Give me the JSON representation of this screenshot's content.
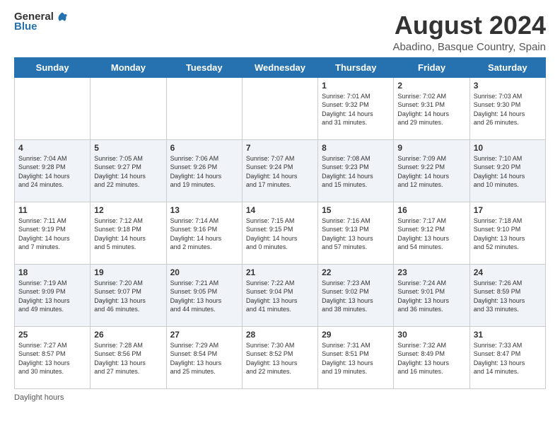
{
  "logo": {
    "general": "General",
    "blue": "Blue"
  },
  "title": "August 2024",
  "subtitle": "Abadino, Basque Country, Spain",
  "headers": [
    "Sunday",
    "Monday",
    "Tuesday",
    "Wednesday",
    "Thursday",
    "Friday",
    "Saturday"
  ],
  "weeks": [
    [
      {
        "day": "",
        "info": ""
      },
      {
        "day": "",
        "info": ""
      },
      {
        "day": "",
        "info": ""
      },
      {
        "day": "",
        "info": ""
      },
      {
        "day": "1",
        "info": "Sunrise: 7:01 AM\nSunset: 9:32 PM\nDaylight: 14 hours\nand 31 minutes."
      },
      {
        "day": "2",
        "info": "Sunrise: 7:02 AM\nSunset: 9:31 PM\nDaylight: 14 hours\nand 29 minutes."
      },
      {
        "day": "3",
        "info": "Sunrise: 7:03 AM\nSunset: 9:30 PM\nDaylight: 14 hours\nand 26 minutes."
      }
    ],
    [
      {
        "day": "4",
        "info": "Sunrise: 7:04 AM\nSunset: 9:28 PM\nDaylight: 14 hours\nand 24 minutes."
      },
      {
        "day": "5",
        "info": "Sunrise: 7:05 AM\nSunset: 9:27 PM\nDaylight: 14 hours\nand 22 minutes."
      },
      {
        "day": "6",
        "info": "Sunrise: 7:06 AM\nSunset: 9:26 PM\nDaylight: 14 hours\nand 19 minutes."
      },
      {
        "day": "7",
        "info": "Sunrise: 7:07 AM\nSunset: 9:24 PM\nDaylight: 14 hours\nand 17 minutes."
      },
      {
        "day": "8",
        "info": "Sunrise: 7:08 AM\nSunset: 9:23 PM\nDaylight: 14 hours\nand 15 minutes."
      },
      {
        "day": "9",
        "info": "Sunrise: 7:09 AM\nSunset: 9:22 PM\nDaylight: 14 hours\nand 12 minutes."
      },
      {
        "day": "10",
        "info": "Sunrise: 7:10 AM\nSunset: 9:20 PM\nDaylight: 14 hours\nand 10 minutes."
      }
    ],
    [
      {
        "day": "11",
        "info": "Sunrise: 7:11 AM\nSunset: 9:19 PM\nDaylight: 14 hours\nand 7 minutes."
      },
      {
        "day": "12",
        "info": "Sunrise: 7:12 AM\nSunset: 9:18 PM\nDaylight: 14 hours\nand 5 minutes."
      },
      {
        "day": "13",
        "info": "Sunrise: 7:14 AM\nSunset: 9:16 PM\nDaylight: 14 hours\nand 2 minutes."
      },
      {
        "day": "14",
        "info": "Sunrise: 7:15 AM\nSunset: 9:15 PM\nDaylight: 14 hours\nand 0 minutes."
      },
      {
        "day": "15",
        "info": "Sunrise: 7:16 AM\nSunset: 9:13 PM\nDaylight: 13 hours\nand 57 minutes."
      },
      {
        "day": "16",
        "info": "Sunrise: 7:17 AM\nSunset: 9:12 PM\nDaylight: 13 hours\nand 54 minutes."
      },
      {
        "day": "17",
        "info": "Sunrise: 7:18 AM\nSunset: 9:10 PM\nDaylight: 13 hours\nand 52 minutes."
      }
    ],
    [
      {
        "day": "18",
        "info": "Sunrise: 7:19 AM\nSunset: 9:09 PM\nDaylight: 13 hours\nand 49 minutes."
      },
      {
        "day": "19",
        "info": "Sunrise: 7:20 AM\nSunset: 9:07 PM\nDaylight: 13 hours\nand 46 minutes."
      },
      {
        "day": "20",
        "info": "Sunrise: 7:21 AM\nSunset: 9:05 PM\nDaylight: 13 hours\nand 44 minutes."
      },
      {
        "day": "21",
        "info": "Sunrise: 7:22 AM\nSunset: 9:04 PM\nDaylight: 13 hours\nand 41 minutes."
      },
      {
        "day": "22",
        "info": "Sunrise: 7:23 AM\nSunset: 9:02 PM\nDaylight: 13 hours\nand 38 minutes."
      },
      {
        "day": "23",
        "info": "Sunrise: 7:24 AM\nSunset: 9:01 PM\nDaylight: 13 hours\nand 36 minutes."
      },
      {
        "day": "24",
        "info": "Sunrise: 7:26 AM\nSunset: 8:59 PM\nDaylight: 13 hours\nand 33 minutes."
      }
    ],
    [
      {
        "day": "25",
        "info": "Sunrise: 7:27 AM\nSunset: 8:57 PM\nDaylight: 13 hours\nand 30 minutes."
      },
      {
        "day": "26",
        "info": "Sunrise: 7:28 AM\nSunset: 8:56 PM\nDaylight: 13 hours\nand 27 minutes."
      },
      {
        "day": "27",
        "info": "Sunrise: 7:29 AM\nSunset: 8:54 PM\nDaylight: 13 hours\nand 25 minutes."
      },
      {
        "day": "28",
        "info": "Sunrise: 7:30 AM\nSunset: 8:52 PM\nDaylight: 13 hours\nand 22 minutes."
      },
      {
        "day": "29",
        "info": "Sunrise: 7:31 AM\nSunset: 8:51 PM\nDaylight: 13 hours\nand 19 minutes."
      },
      {
        "day": "30",
        "info": "Sunrise: 7:32 AM\nSunset: 8:49 PM\nDaylight: 13 hours\nand 16 minutes."
      },
      {
        "day": "31",
        "info": "Sunrise: 7:33 AM\nSunset: 8:47 PM\nDaylight: 13 hours\nand 14 minutes."
      }
    ]
  ],
  "footer": "Daylight hours"
}
